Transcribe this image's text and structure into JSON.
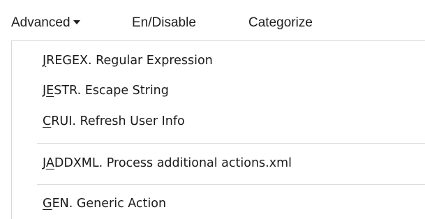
{
  "menubar": {
    "advanced": "Advanced",
    "endisable": "En/Disable",
    "categorize": "Categorize"
  },
  "dropdown": {
    "items": [
      {
        "mnemonic_prefix": "",
        "mnemonic": "J",
        "rest": "REGEX. Regular Expression"
      },
      {
        "mnemonic_prefix": "J",
        "mnemonic": "E",
        "rest": "STR. Escape String"
      },
      {
        "mnemonic_prefix": "",
        "mnemonic": "C",
        "rest": "RUI. Refresh User Info"
      },
      {
        "mnemonic_prefix": "J",
        "mnemonic": "A",
        "rest": "DDXML. Process additional actions.xml"
      },
      {
        "mnemonic_prefix": "",
        "mnemonic": "G",
        "rest": "EN. Generic Action"
      }
    ]
  },
  "icons": {
    "advanced_caret": "caret-down-icon"
  }
}
